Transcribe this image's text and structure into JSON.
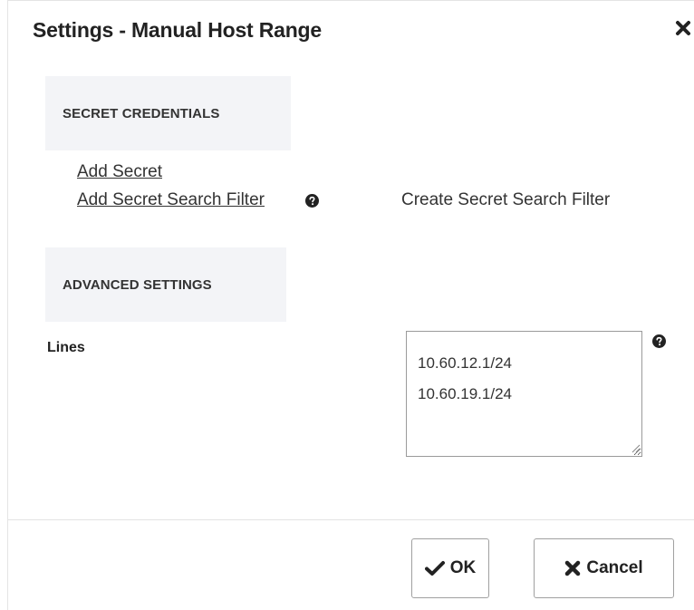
{
  "dialog": {
    "title": "Settings - Manual Host Range",
    "close_icon": "close-icon"
  },
  "secret_credentials": {
    "header": "SECRET CREDENTIALS",
    "add_secret_link": "Add Secret",
    "add_filter_link": "Add Secret Search Filter",
    "help_icon": "question-circle-icon",
    "create_filter_label": "Create Secret Search Filter"
  },
  "advanced_settings": {
    "header": "ADVANCED SETTINGS",
    "lines_label": "Lines",
    "lines_value": "10.60.12.1/24\n10.60.19.1/24",
    "help_icon": "question-circle-icon"
  },
  "footer": {
    "ok_label": "OK",
    "ok_icon": "check-icon",
    "cancel_label": "Cancel",
    "cancel_icon": "x-icon"
  }
}
